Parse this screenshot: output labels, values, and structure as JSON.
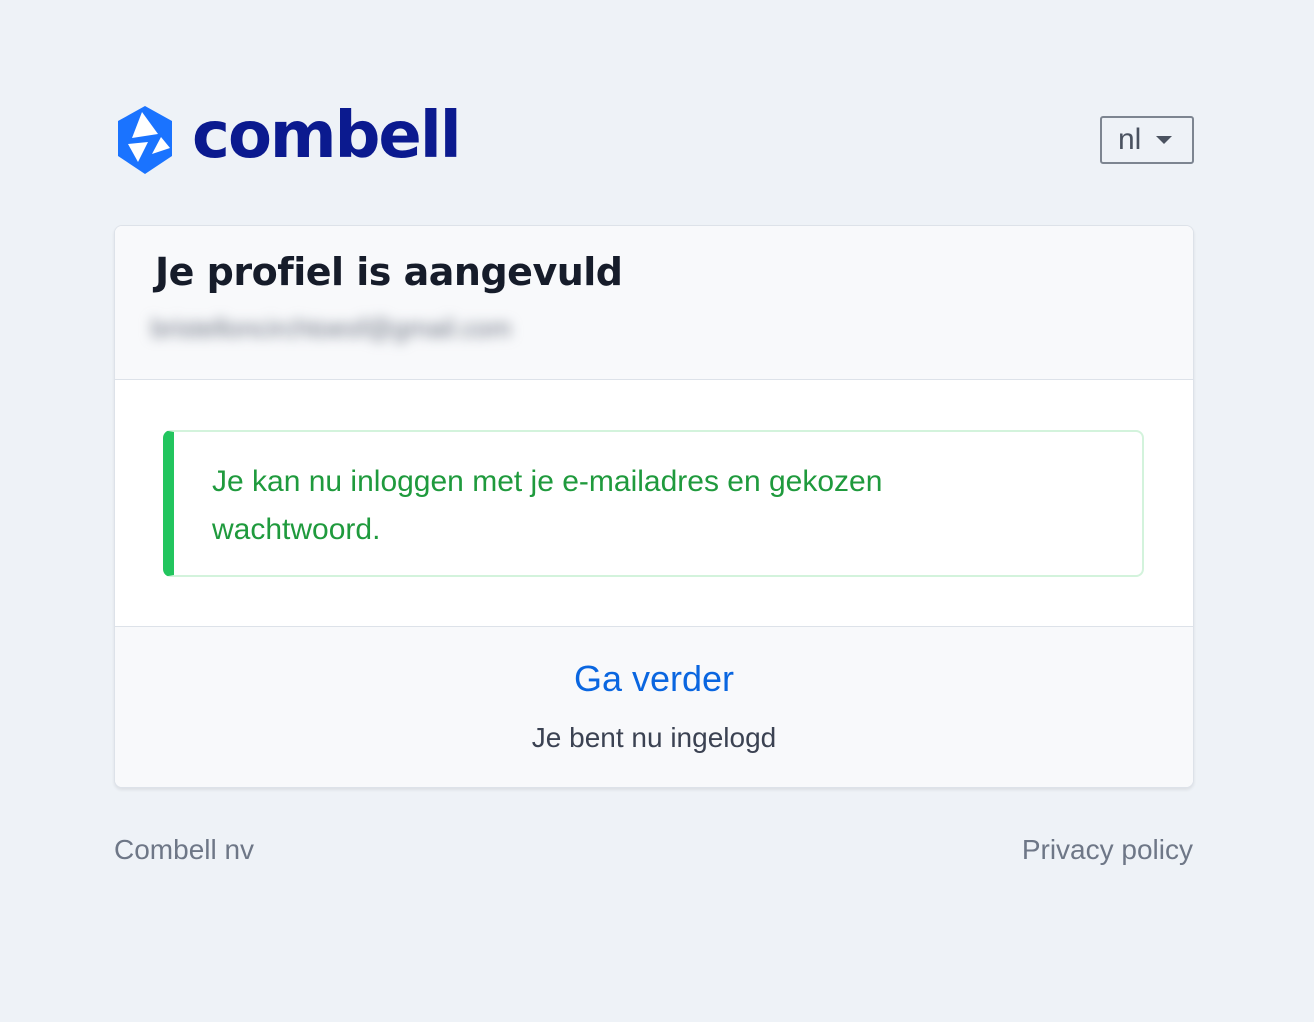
{
  "brand": {
    "name": "combell",
    "primary_color": "#0b1a8f",
    "accent_color": "#1a73ff"
  },
  "language_select": {
    "value": "nl",
    "icon": "caret-down-icon"
  },
  "card": {
    "title": "Je profiel is aangevuld",
    "email_masked": "bristelloncirchtoesf@gmail.com",
    "alert": {
      "type": "success",
      "text": "Je kan nu inloggen met je e-mailadres en gekozen wachtwoord.",
      "color": "#1f9a3d",
      "border_color": "#22c55e"
    },
    "continue_label": "Ga verder",
    "status_text": "Je bent nu ingelogd"
  },
  "footer": {
    "company": "Combell nv",
    "privacy_label": "Privacy policy"
  }
}
